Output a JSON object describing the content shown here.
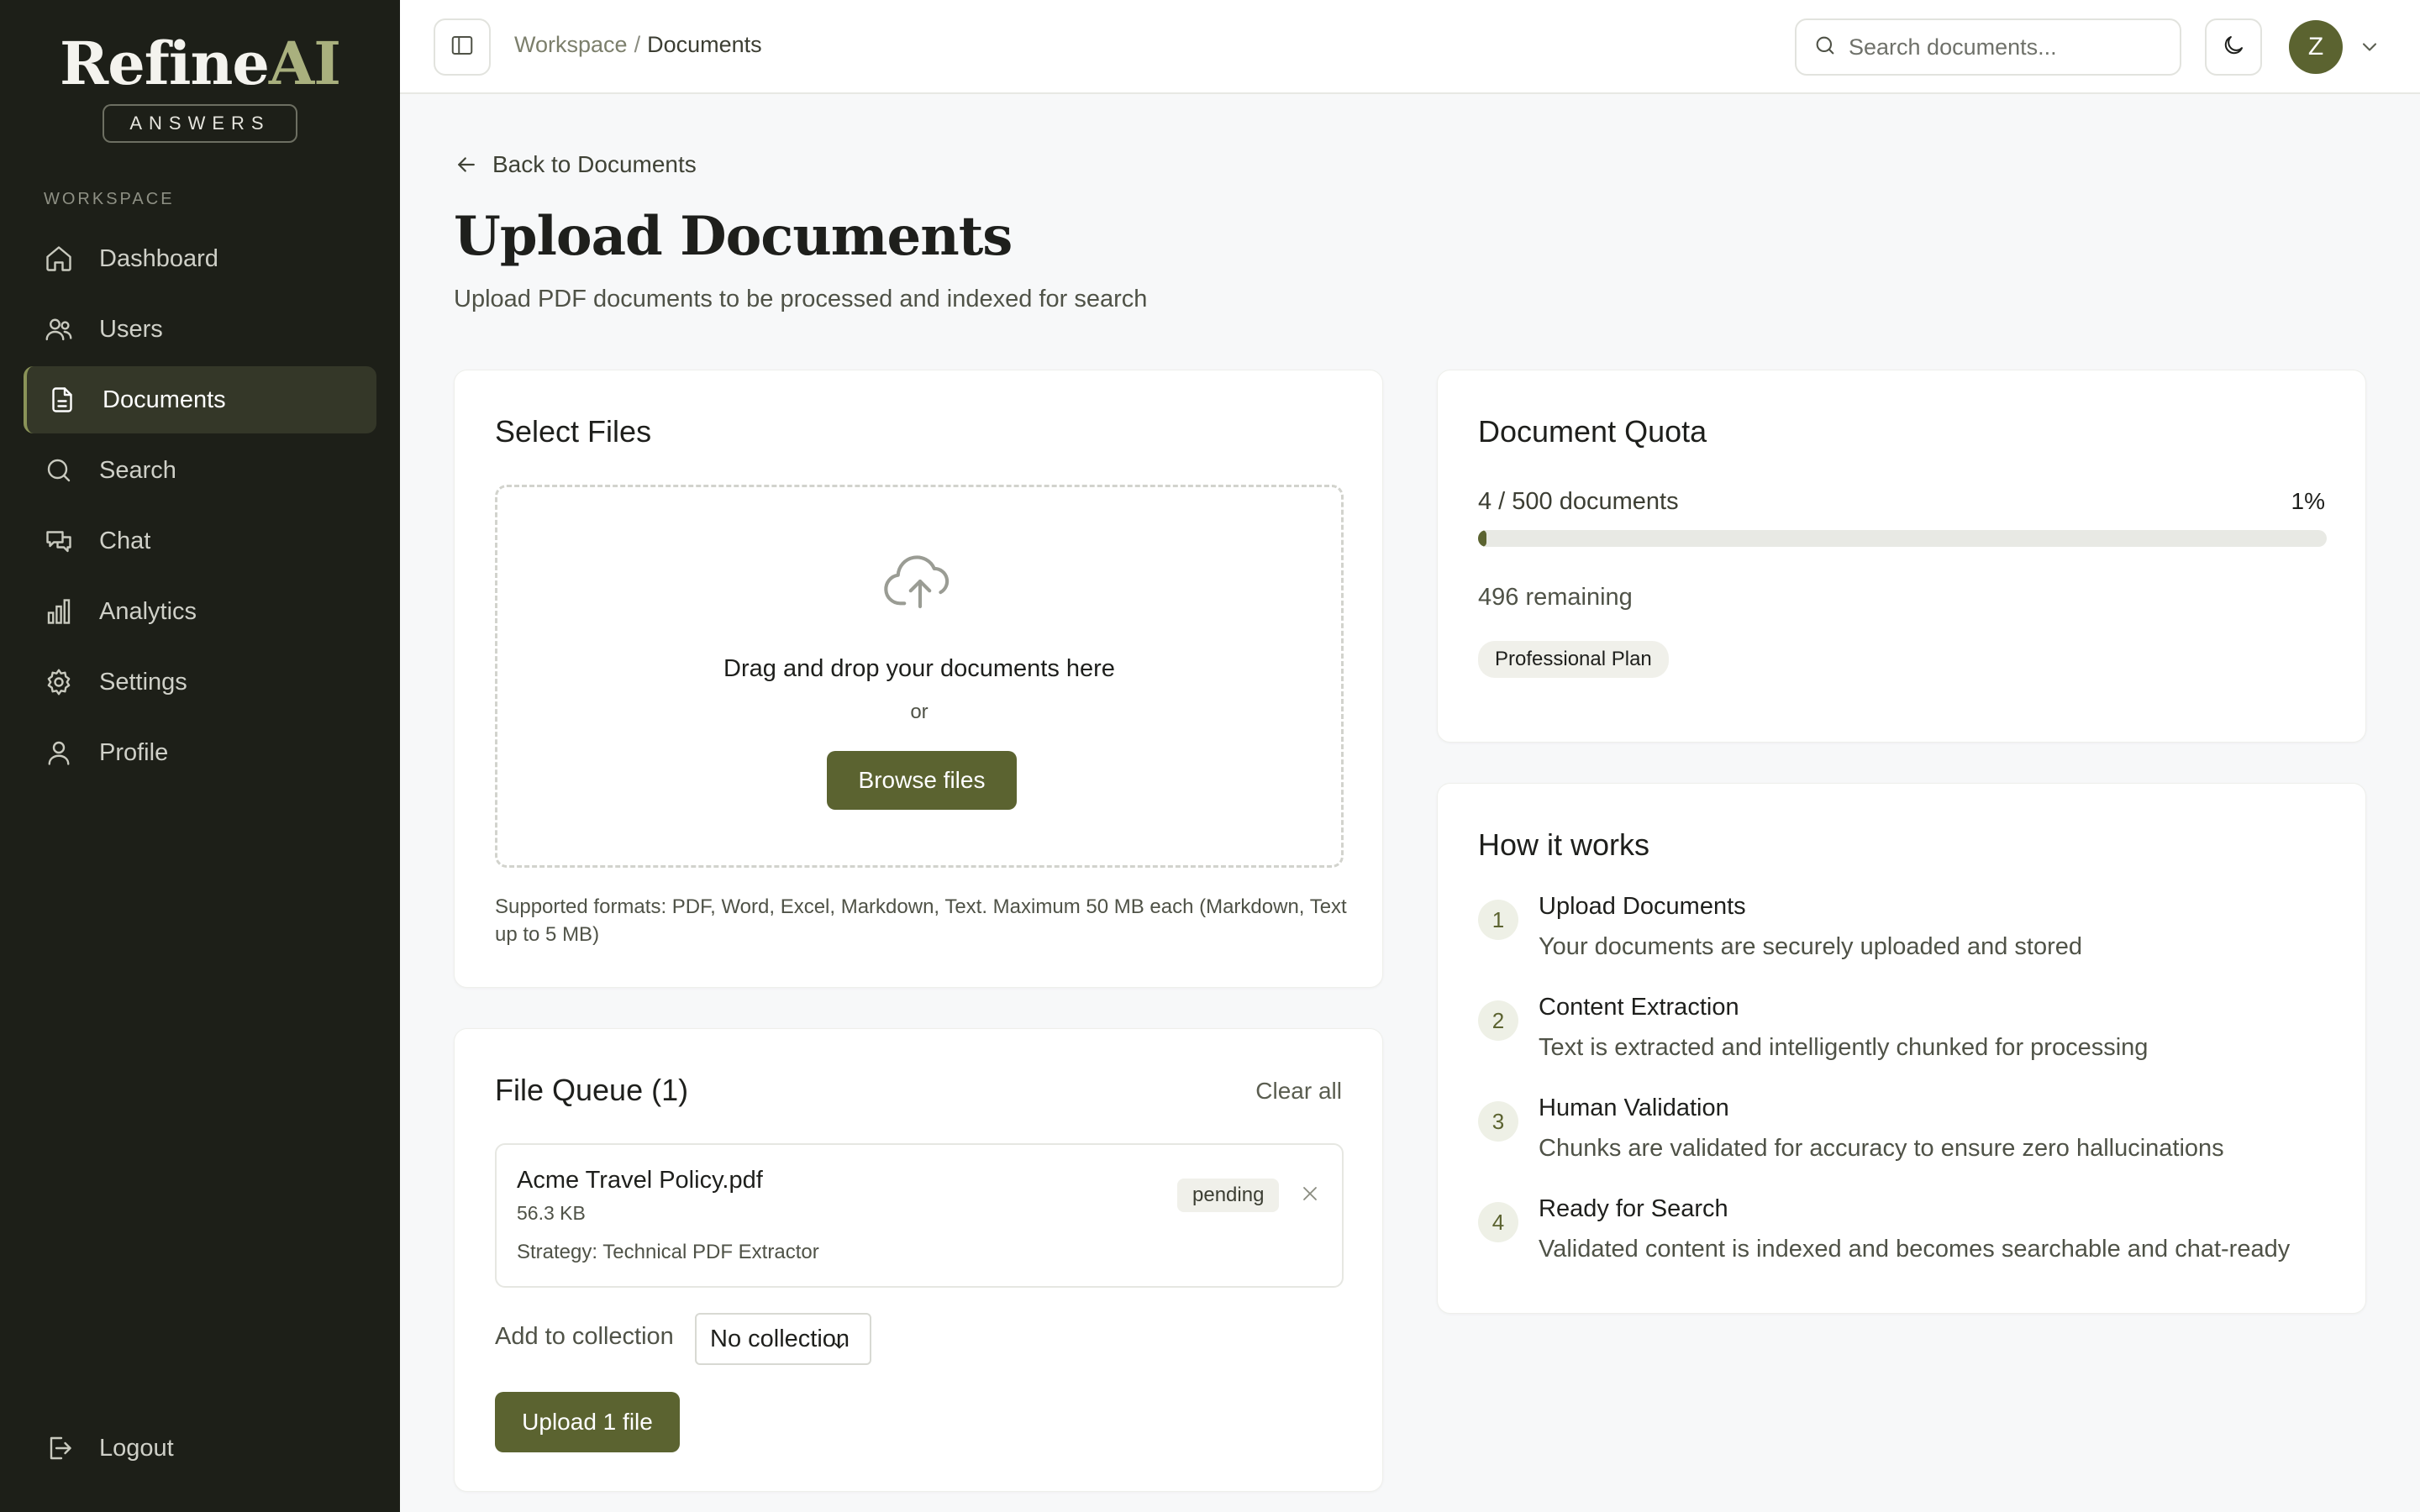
{
  "brand": {
    "name_main": "Refine",
    "name_accent": "AI",
    "badge": "ANSWERS"
  },
  "sidebar": {
    "section_label": "WORKSPACE",
    "items": [
      {
        "label": "Dashboard",
        "icon": "home-icon"
      },
      {
        "label": "Users",
        "icon": "users-icon"
      },
      {
        "label": "Documents",
        "icon": "document-icon",
        "active": true
      },
      {
        "label": "Search",
        "icon": "search-icon"
      },
      {
        "label": "Chat",
        "icon": "chat-icon"
      },
      {
        "label": "Analytics",
        "icon": "bar-chart-icon"
      },
      {
        "label": "Settings",
        "icon": "gear-icon"
      },
      {
        "label": "Profile",
        "icon": "user-icon"
      }
    ],
    "logout_label": "Logout"
  },
  "topbar": {
    "breadcrumb": {
      "parent": "Workspace",
      "separator": "/",
      "current": "Documents"
    },
    "search_placeholder": "Search documents...",
    "avatar_initial": "Z"
  },
  "page": {
    "back_label": "Back to Documents",
    "title": "Upload Documents",
    "subtitle": "Upload PDF documents to be processed and indexed for search"
  },
  "select_files": {
    "title": "Select Files",
    "drop_text": "Drag and drop your documents here",
    "or_text": "or",
    "browse_label": "Browse files",
    "formats_text": "Supported formats: PDF, Word, Excel, Markdown, Text. Maximum 50 MB each (Markdown, Text up to 5 MB)"
  },
  "file_queue": {
    "title": "File Queue (1)",
    "clear_all_label": "Clear all",
    "files": [
      {
        "name": "Acme Travel Policy.pdf",
        "size": "56.3 KB",
        "strategy": "Strategy: Technical PDF Extractor",
        "status": "pending"
      }
    ],
    "collection_label": "Add to collection",
    "collection_value": "No collection",
    "upload_label": "Upload 1 file"
  },
  "quota": {
    "title": "Document Quota",
    "count_text": "4 / 500 documents",
    "percent_text": "1%",
    "used_fraction": 0.008,
    "remaining_text": "496 remaining",
    "plan": "Professional Plan"
  },
  "how_it_works": {
    "title": "How it works",
    "steps": [
      {
        "num": "1",
        "title": "Upload Documents",
        "desc": "Your documents are securely uploaded and stored"
      },
      {
        "num": "2",
        "title": "Content Extraction",
        "desc": "Text is extracted and intelligently chunked for processing"
      },
      {
        "num": "3",
        "title": "Human Validation",
        "desc": "Chunks are validated for accuracy to ensure zero hallucinations"
      },
      {
        "num": "4",
        "title": "Ready for Search",
        "desc": "Validated content is indexed and becomes searchable and chat-ready"
      }
    ]
  },
  "colors": {
    "sidebar_bg": "#1d1f18",
    "accent": "#5b6330",
    "brand_accent": "#a9b07e",
    "page_bg": "#f7f8f9"
  }
}
